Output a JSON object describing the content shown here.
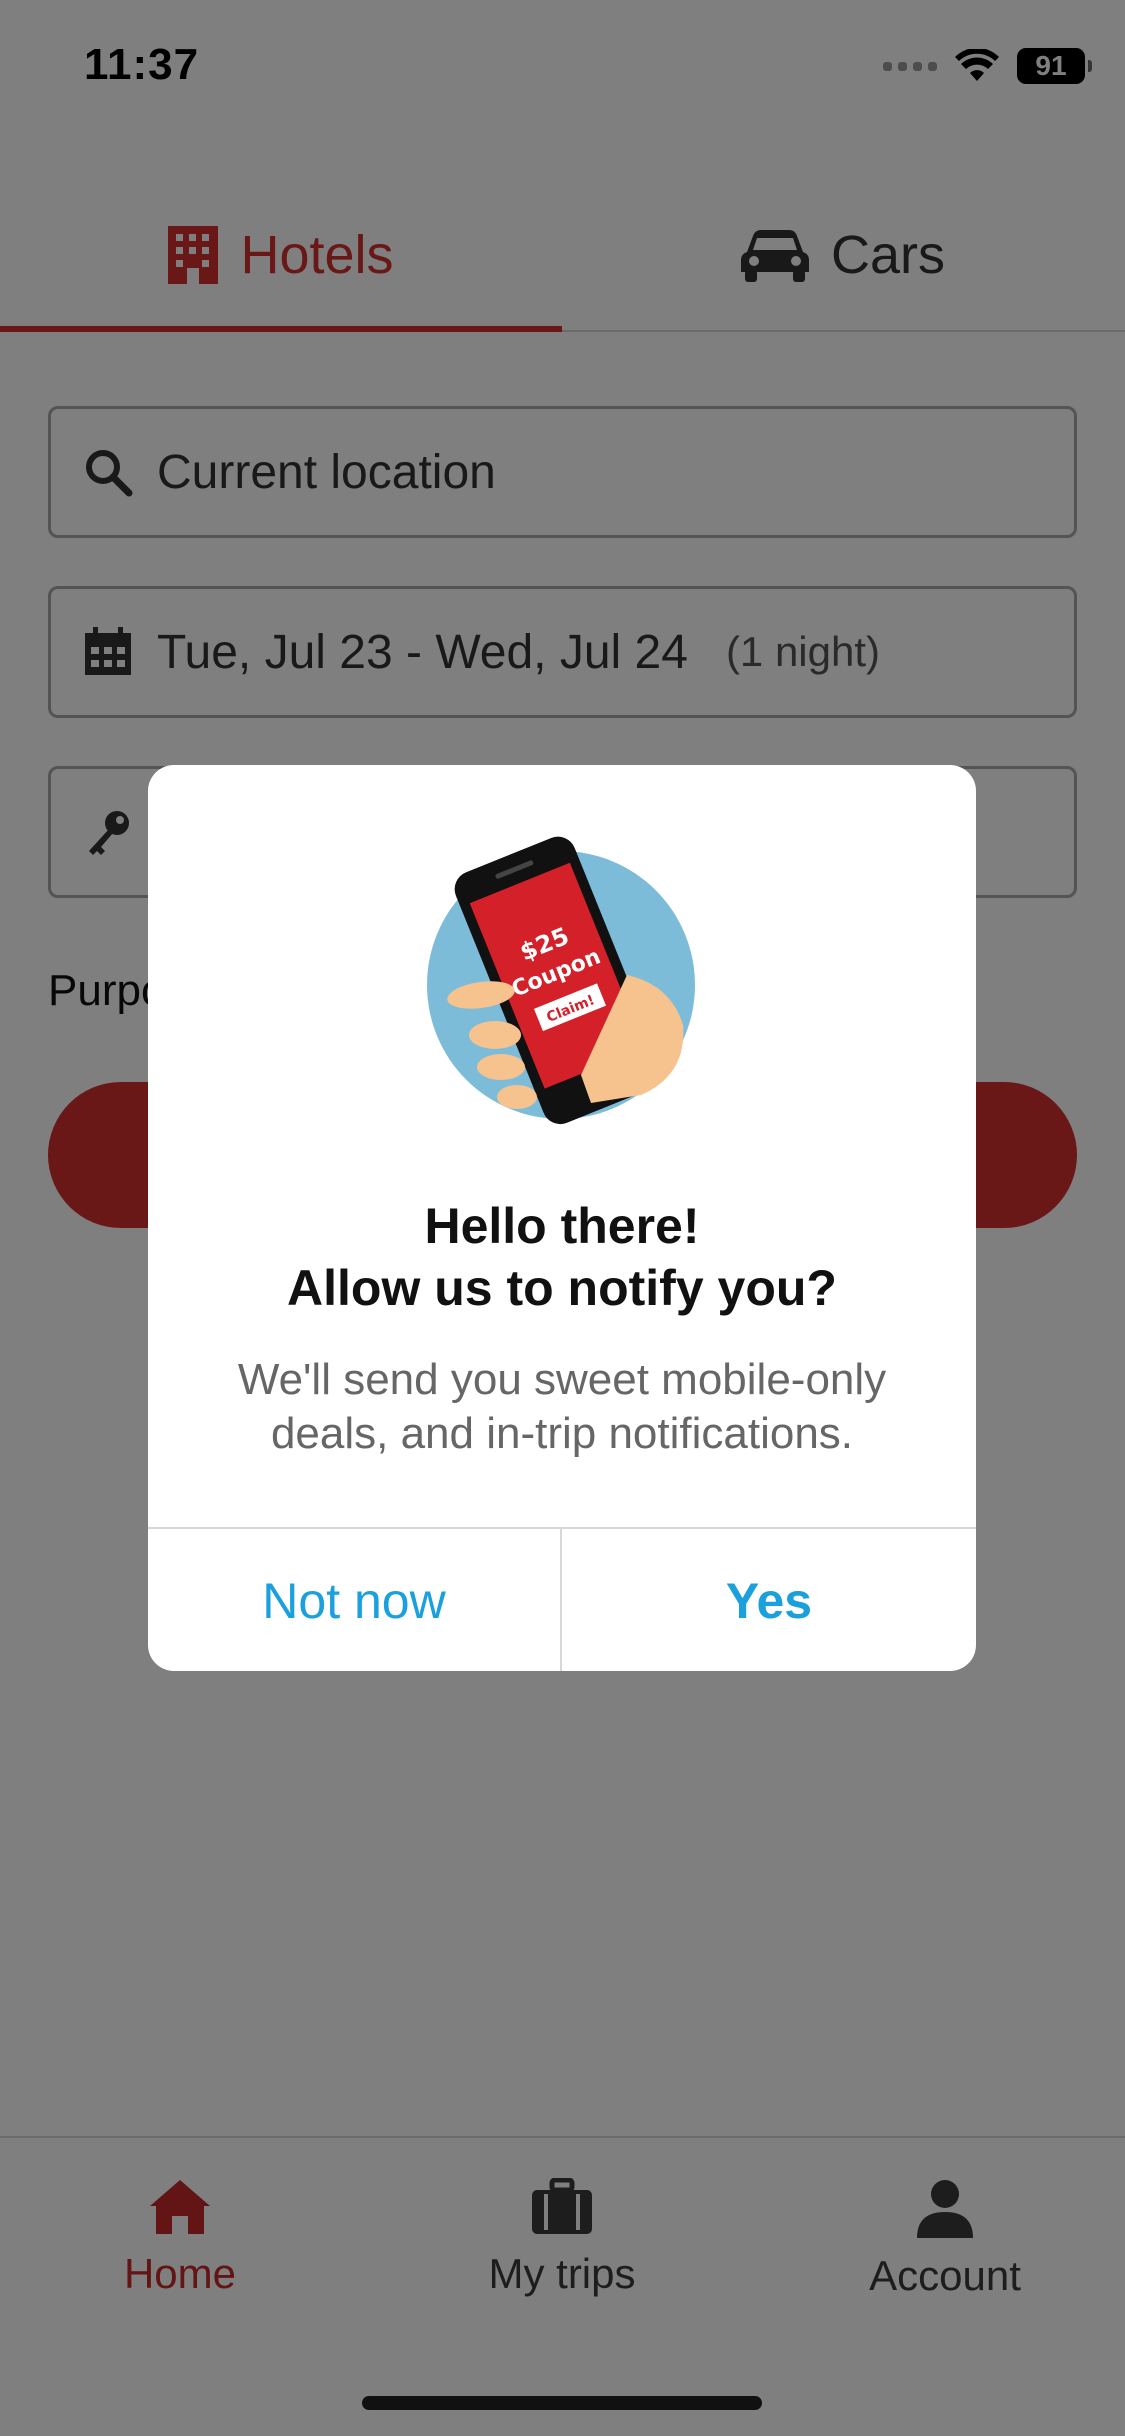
{
  "status_bar": {
    "time": "11:37",
    "battery": "91"
  },
  "tabs": [
    {
      "label": "Hotels",
      "icon": "building-icon",
      "active": true
    },
    {
      "label": "Cars",
      "icon": "car-icon",
      "active": false
    }
  ],
  "search": {
    "location": "Current location",
    "dates": "Tue, Jul 23 - Wed, Jul 24",
    "nights": "(1 night)",
    "purpose_label_visible": "Purpo"
  },
  "dialog": {
    "illustration": {
      "amount": "$25",
      "word": "Coupon",
      "button": "Claim!"
    },
    "title_line1": "Hello there!",
    "title_line2": "Allow us to notify you?",
    "body_line1": "We'll send you sweet mobile-only",
    "body_line2": "deals, and in-trip notifications.",
    "secondary_button": "Not now",
    "primary_button": "Yes"
  },
  "bottom_nav": [
    {
      "label": "Home",
      "icon": "home-icon",
      "active": true
    },
    {
      "label": "My trips",
      "icon": "briefcase-icon",
      "active": false
    },
    {
      "label": "Account",
      "icon": "person-icon",
      "active": false
    }
  ],
  "colors": {
    "brand_red": "#d32f2f",
    "link_blue": "#1aa0dc",
    "overlay": "rgba(0,0,0,0.5)"
  }
}
